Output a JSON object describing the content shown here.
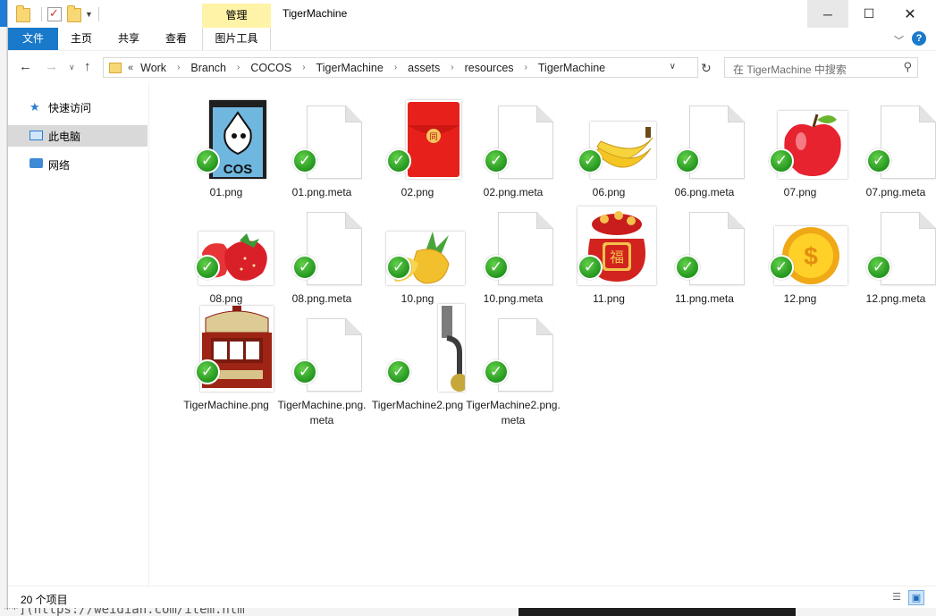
{
  "window": {
    "title": "TigerMachine",
    "context_tab_group": "管理",
    "controls": {
      "minimize": "─",
      "maximize": "☐",
      "close": "✕"
    }
  },
  "ribbon": {
    "tabs": [
      "文件",
      "主页",
      "共享",
      "查看",
      "图片工具"
    ],
    "expand_icon": "chevron-down",
    "help": "?"
  },
  "address": {
    "overflow": "«",
    "crumbs": [
      "Work",
      "Branch",
      "COCOS",
      "TigerMachine",
      "assets",
      "resources",
      "TigerMachine"
    ],
    "search_placeholder": "在 TigerMachine 中搜索"
  },
  "sidebar": {
    "items": [
      {
        "label": "快速访问",
        "icon": "star-icon",
        "selected": false
      },
      {
        "label": "此电脑",
        "icon": "computer-icon",
        "selected": true
      },
      {
        "label": "网络",
        "icon": "network-icon",
        "selected": false
      }
    ]
  },
  "files": [
    {
      "name": "01.png",
      "kind": "cocos"
    },
    {
      "name": "01.png.meta",
      "kind": "doc"
    },
    {
      "name": "02.png",
      "kind": "redpacket"
    },
    {
      "name": "02.png.meta",
      "kind": "doc"
    },
    {
      "name": "06.png",
      "kind": "banana"
    },
    {
      "name": "06.png.meta",
      "kind": "doc"
    },
    {
      "name": "07.png",
      "kind": "apple"
    },
    {
      "name": "07.png.meta",
      "kind": "doc"
    },
    {
      "name": "08.png",
      "kind": "strawberry"
    },
    {
      "name": "08.png.meta",
      "kind": "doc"
    },
    {
      "name": "10.png",
      "kind": "pineapple"
    },
    {
      "name": "10.png.meta",
      "kind": "doc"
    },
    {
      "name": "11.png",
      "kind": "luckybag"
    },
    {
      "name": "11.png.meta",
      "kind": "doc"
    },
    {
      "name": "12.png",
      "kind": "coin"
    },
    {
      "name": "12.png.meta",
      "kind": "doc"
    },
    {
      "name": "TigerMachine.png",
      "kind": "slotmachine"
    },
    {
      "name": "TigerMachine.png.meta",
      "kind": "doc"
    },
    {
      "name": "TigerMachine2.png",
      "kind": "lever"
    },
    {
      "name": "TigerMachine2.png.meta",
      "kind": "doc"
    }
  ],
  "thumb_text": {
    "cocos": "COS",
    "redpacket": "同",
    "luckybag": "福",
    "coin": "$"
  },
  "status": {
    "count": "20 个项目"
  },
  "background_text": "**](https://weidian.com/item.htm"
}
